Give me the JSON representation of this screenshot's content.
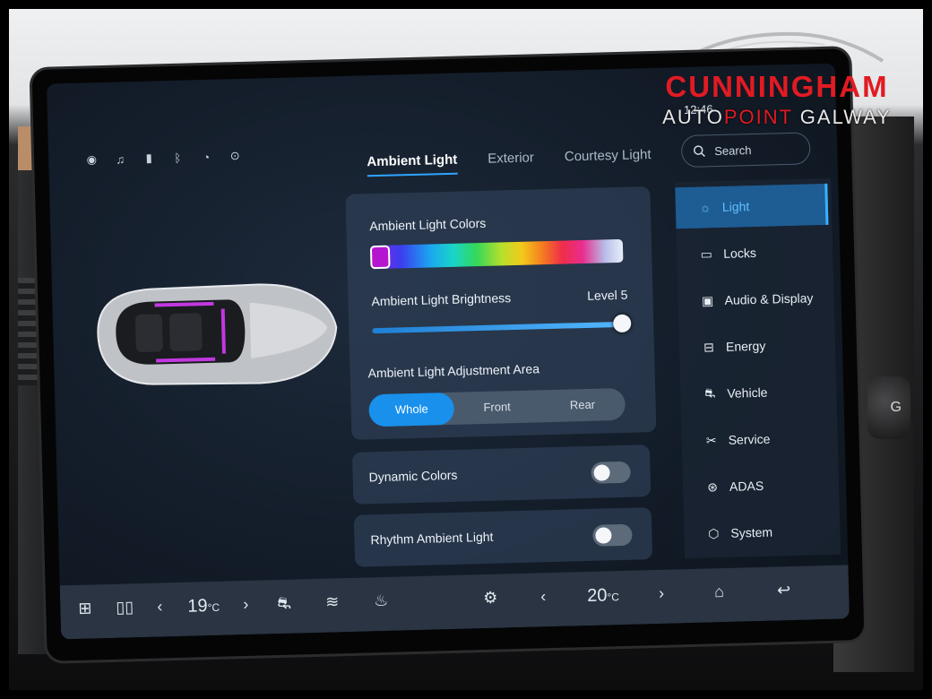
{
  "brand": {
    "name": "CUNNINGHAM",
    "sub_a": "AUTO",
    "sub_b": "POINT",
    "sub_c": " GALWAY"
  },
  "clock": "12:46",
  "tabs": [
    {
      "label": "Ambient Light",
      "active": true
    },
    {
      "label": "Exterior",
      "active": false
    },
    {
      "label": "Courtesy Light",
      "active": false
    }
  ],
  "search": {
    "placeholder": "Search",
    "icon": "search-icon"
  },
  "ambient": {
    "colors_title": "Ambient Light Colors",
    "selected_color": "#b515cf",
    "brightness_title": "Ambient Light Brightness",
    "brightness_value": "Level 5",
    "brightness_fraction": 1.0,
    "area_title": "Ambient Light Adjustment Area",
    "areas": [
      "Whole",
      "Front",
      "Rear"
    ],
    "area_selected": "Whole"
  },
  "dynamic_colors": {
    "label": "Dynamic Colors",
    "on": false
  },
  "rhythm": {
    "label": "Rhythm Ambient Light",
    "on": false
  },
  "menu": [
    {
      "label": "Light",
      "icon": "sun-icon",
      "active": true
    },
    {
      "label": "Locks",
      "icon": "lock-icon",
      "active": false
    },
    {
      "label": "Audio & Display",
      "icon": "display-icon",
      "active": false
    },
    {
      "label": "Energy",
      "icon": "battery-icon",
      "active": false
    },
    {
      "label": "Vehicle",
      "icon": "car-icon",
      "active": false
    },
    {
      "label": "Service",
      "icon": "wrench-icon",
      "active": false
    },
    {
      "label": "ADAS",
      "icon": "steering-icon",
      "active": false
    },
    {
      "label": "System",
      "icon": "hexagon-icon",
      "active": false
    }
  ],
  "climate": {
    "left_temp": "19",
    "right_temp": "20",
    "unit": "°C"
  },
  "colors": {
    "accent": "#1890ec",
    "active_text": "#5fc2ff",
    "brand_red": "#e11b23"
  }
}
